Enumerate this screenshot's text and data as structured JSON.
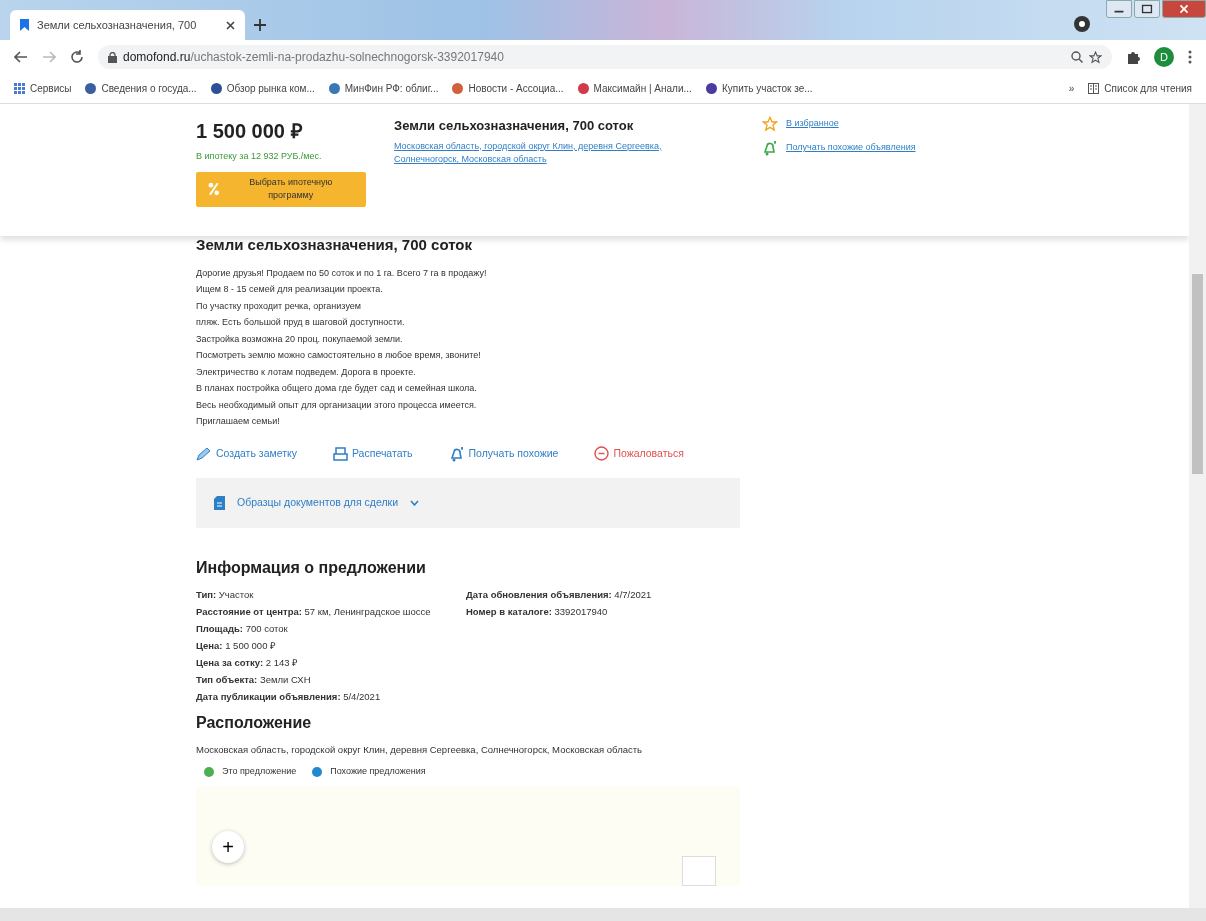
{
  "browser": {
    "tab_title": "Земли сельхозназначения, 700",
    "url_host": "domofond.ru",
    "url_path": "/uchastok-zemli-na-prodazhu-solnechnogorsk-3392017940",
    "avatar": "D",
    "bookmarks": [
      {
        "label": "Сервисы",
        "color": "#4a7bd0"
      },
      {
        "label": "Сведения о госуда...",
        "color": "#3b5f9e"
      },
      {
        "label": "Обзор рынка ком...",
        "color": "#2c4f95"
      },
      {
        "label": "МинФин РФ: облиг...",
        "color": "#3a78b5"
      },
      {
        "label": "Новости - Ассоциа...",
        "color": "#d2603a"
      },
      {
        "label": "Максимайн | Анали...",
        "color": "#d23a4a"
      },
      {
        "label": "Купить участок зе...",
        "color": "#4b3ba0"
      }
    ],
    "more": "»",
    "reading_list": "Список для чтения"
  },
  "header": {
    "price": "1 500 000 ₽",
    "mortgage": "В ипотеку за 12 932 РУБ./мес.",
    "mortgage_button": "Выбрать ипотечную программу",
    "title": "Земли сельхозназначения, 700 соток",
    "address": "Московская область, городской округ Клин, деревня Сергеевка, Солнечногорск, Московская область",
    "actions": [
      {
        "kind": "favorite",
        "label": "В избранное"
      },
      {
        "kind": "subscribe",
        "label": "Получать похожие объявления"
      }
    ]
  },
  "listing": {
    "title": "Земли сельхозназначения, 700 соток",
    "description": [
      "Дорогие друзья! Продаем по 50 соток и по 1 га. Всего 7 га в продажу!",
      "Ищем 8 - 15 семей для реализации проекта.",
      "По участку проходит речка, организуем",
      "пляж. Есть большой пруд в шаговой доступности.",
      "Застройка возможна 20 проц. покупаемой земли.",
      "Посмотреть землю можно самостоятельно в любое время, звоните!",
      "Электричество к лотам подведем. Дорога в проекте.",
      "В планах постройка общего дома где будет сад и семейная школа.",
      "Весь необходимый опыт для организации этого процесса имеется.",
      "Приглашаем семьи!"
    ],
    "actions": [
      {
        "kind": "note",
        "label": "Создать заметку"
      },
      {
        "kind": "print",
        "label": "Распечатать"
      },
      {
        "kind": "subscribe",
        "label": "Получать похожие"
      },
      {
        "kind": "report",
        "label": "Пожаловаться"
      }
    ],
    "documents": {
      "label": "Образцы документов для сделки",
      "expanded": false
    }
  },
  "info": {
    "title": "Информация о предложении",
    "left": [
      {
        "label": "Тип:",
        "value": "Участок"
      },
      {
        "label": "Расстояние от центра:",
        "value": "57 км, Ленинградское шоссе"
      },
      {
        "label": "Площадь:",
        "value": "700 соток"
      },
      {
        "label": "Цена:",
        "value": "1 500 000 ₽"
      },
      {
        "label": "Цена за сотку:",
        "value": "2 143 ₽"
      },
      {
        "label": "Тип объекта:",
        "value": "Земли СХН"
      },
      {
        "label": "Дата публикации объявления:",
        "value": "5/4/2021"
      }
    ],
    "right": [
      {
        "label": "Дата обновления объявления:",
        "value": "4/7/2021"
      },
      {
        "label": "Номер в каталоге:",
        "value": "3392017940"
      }
    ]
  },
  "location": {
    "title": "Расположение",
    "address": "Московская область, городской округ Клин, деревня Сергеевка, Солнечногорск, Московская область",
    "legend": [
      {
        "label": "Это предложение",
        "color": "#4caf50"
      },
      {
        "label": "Похожие предложения",
        "color": "#1e88d0"
      }
    ],
    "zoom_in": "+"
  }
}
